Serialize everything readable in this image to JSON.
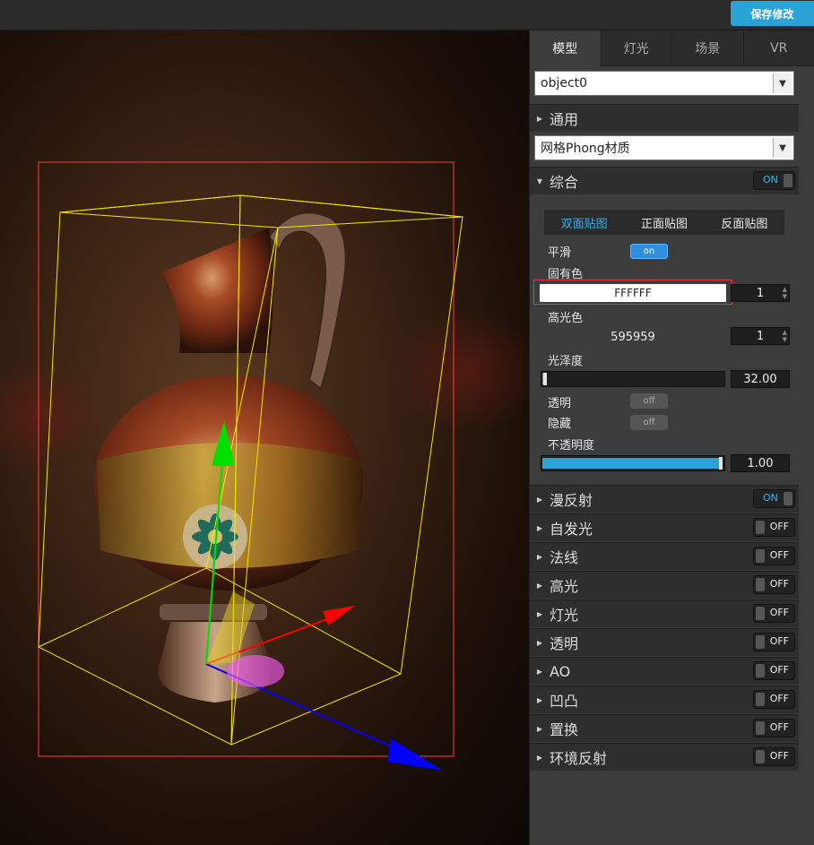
{
  "toolbar": {
    "save_label": "保存修改"
  },
  "tabs": [
    {
      "label": "模型"
    },
    {
      "label": "灯光"
    },
    {
      "label": "场景"
    },
    {
      "label": "VR"
    }
  ],
  "object_select": {
    "value": "object0"
  },
  "general": {
    "label": "通用"
  },
  "material_select": {
    "value": "网格Phong材质"
  },
  "composite": {
    "label": "综合",
    "toggle": "ON",
    "sub_tabs": [
      {
        "label": "双面贴图"
      },
      {
        "label": "正面贴图"
      },
      {
        "label": "反面贴图"
      }
    ],
    "smooth": {
      "label": "平滑",
      "toggle": "on"
    },
    "base_color": {
      "label": "固有色",
      "hex": "FFFFFF",
      "intensity": "1"
    },
    "specular_color": {
      "label": "高光色",
      "hex": "595959",
      "intensity": "1"
    },
    "shininess": {
      "label": "光泽度",
      "value": "32.00",
      "fraction": 0.03
    },
    "transparent": {
      "label": "透明",
      "toggle": "off"
    },
    "hidden": {
      "label": "隐藏",
      "toggle": "off"
    },
    "opacity": {
      "label": "不透明度",
      "value": "1.00",
      "fraction": 1.0
    }
  },
  "sections": [
    {
      "label": "漫反射",
      "toggle": "ON"
    },
    {
      "label": "自发光",
      "toggle": "OFF"
    },
    {
      "label": "法线",
      "toggle": "OFF"
    },
    {
      "label": "高光",
      "toggle": "OFF"
    },
    {
      "label": "灯光",
      "toggle": "OFF"
    },
    {
      "label": "透明",
      "toggle": "OFF"
    },
    {
      "label": "AO",
      "toggle": "OFF"
    },
    {
      "label": "凹凸",
      "toggle": "OFF"
    },
    {
      "label": "置换",
      "toggle": "OFF"
    },
    {
      "label": "环境反射",
      "toggle": "OFF"
    }
  ],
  "colors": {
    "accent": "#2aa3d6",
    "selection_box": "#ff3b3b",
    "bbox": "#f2e600",
    "axis_x": "#ff0000",
    "axis_y": "#00e000",
    "axis_z": "#0000ff"
  }
}
